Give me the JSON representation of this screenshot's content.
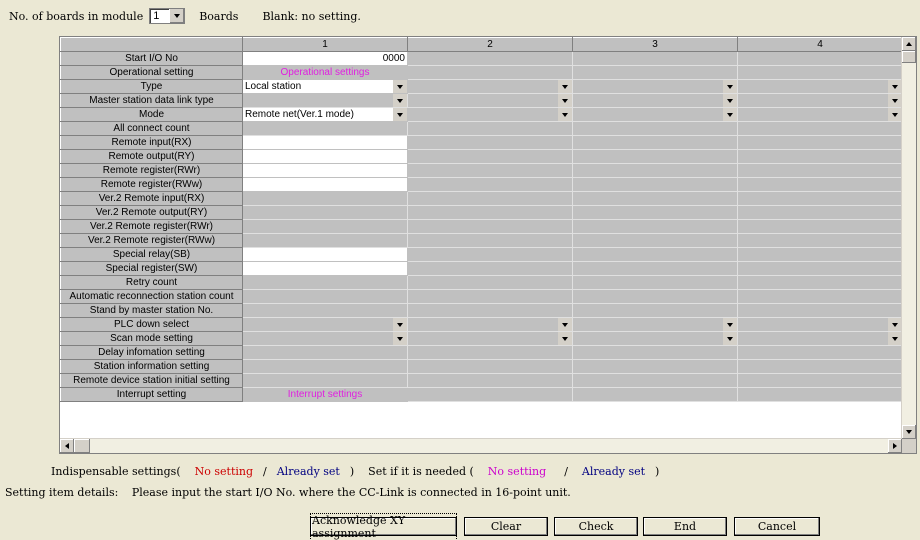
{
  "top": {
    "boards_label": "No. of boards in module",
    "boards_value": "1",
    "boards_unit": "Boards",
    "blank_note": "Blank: no setting."
  },
  "grid": {
    "columns": [
      "1",
      "2",
      "3",
      "4"
    ],
    "rows": [
      {
        "label": "Start I/O No",
        "cells": [
          {
            "t": "w",
            "v": "0000",
            "num": true
          },
          {
            "t": "g"
          },
          {
            "t": "g"
          },
          {
            "t": "g"
          }
        ]
      },
      {
        "label": "Operational setting",
        "cells": [
          {
            "t": "link",
            "v": "Operational settings"
          },
          {
            "t": "g"
          },
          {
            "t": "g"
          },
          {
            "t": "g"
          }
        ]
      },
      {
        "label": "Type",
        "cells": [
          {
            "t": "combo",
            "v": "Local station",
            "bg": "w"
          },
          {
            "t": "combo",
            "v": ""
          },
          {
            "t": "combo",
            "v": ""
          },
          {
            "t": "combo",
            "v": ""
          }
        ]
      },
      {
        "label": "Master station data link type",
        "cells": [
          {
            "t": "combo",
            "v": ""
          },
          {
            "t": "combo",
            "v": ""
          },
          {
            "t": "combo",
            "v": ""
          },
          {
            "t": "combo",
            "v": ""
          }
        ]
      },
      {
        "label": "Mode",
        "cells": [
          {
            "t": "combo",
            "v": "Remote net(Ver.1 mode)",
            "bg": "w"
          },
          {
            "t": "combo",
            "v": ""
          },
          {
            "t": "combo",
            "v": ""
          },
          {
            "t": "combo",
            "v": ""
          }
        ]
      },
      {
        "label": "All connect count",
        "cells": [
          {
            "t": "g"
          },
          {
            "t": "g"
          },
          {
            "t": "g"
          },
          {
            "t": "g"
          }
        ]
      },
      {
        "label": "Remote input(RX)",
        "cells": [
          {
            "t": "w",
            "v": ""
          },
          {
            "t": "g"
          },
          {
            "t": "g"
          },
          {
            "t": "g"
          }
        ]
      },
      {
        "label": "Remote output(RY)",
        "cells": [
          {
            "t": "w",
            "v": ""
          },
          {
            "t": "g"
          },
          {
            "t": "g"
          },
          {
            "t": "g"
          }
        ]
      },
      {
        "label": "Remote register(RWr)",
        "cells": [
          {
            "t": "w",
            "v": ""
          },
          {
            "t": "g"
          },
          {
            "t": "g"
          },
          {
            "t": "g"
          }
        ]
      },
      {
        "label": "Remote register(RWw)",
        "cells": [
          {
            "t": "w",
            "v": ""
          },
          {
            "t": "g"
          },
          {
            "t": "g"
          },
          {
            "t": "g"
          }
        ]
      },
      {
        "label": "Ver.2 Remote input(RX)",
        "cells": [
          {
            "t": "g"
          },
          {
            "t": "g"
          },
          {
            "t": "g"
          },
          {
            "t": "g"
          }
        ]
      },
      {
        "label": "Ver.2 Remote output(RY)",
        "cells": [
          {
            "t": "g"
          },
          {
            "t": "g"
          },
          {
            "t": "g"
          },
          {
            "t": "g"
          }
        ]
      },
      {
        "label": "Ver.2 Remote register(RWr)",
        "cells": [
          {
            "t": "g"
          },
          {
            "t": "g"
          },
          {
            "t": "g"
          },
          {
            "t": "g"
          }
        ]
      },
      {
        "label": "Ver.2 Remote register(RWw)",
        "cells": [
          {
            "t": "g"
          },
          {
            "t": "g"
          },
          {
            "t": "g"
          },
          {
            "t": "g"
          }
        ]
      },
      {
        "label": "Special relay(SB)",
        "cells": [
          {
            "t": "w",
            "v": ""
          },
          {
            "t": "g"
          },
          {
            "t": "g"
          },
          {
            "t": "g"
          }
        ]
      },
      {
        "label": "Special register(SW)",
        "cells": [
          {
            "t": "w",
            "v": ""
          },
          {
            "t": "g"
          },
          {
            "t": "g"
          },
          {
            "t": "g"
          }
        ]
      },
      {
        "label": "Retry count",
        "cells": [
          {
            "t": "g"
          },
          {
            "t": "g"
          },
          {
            "t": "g"
          },
          {
            "t": "g"
          }
        ]
      },
      {
        "label": "Automatic reconnection station count",
        "cells": [
          {
            "t": "g"
          },
          {
            "t": "g"
          },
          {
            "t": "g"
          },
          {
            "t": "g"
          }
        ]
      },
      {
        "label": "Stand by master station No.",
        "cells": [
          {
            "t": "g"
          },
          {
            "t": "g"
          },
          {
            "t": "g"
          },
          {
            "t": "g"
          }
        ]
      },
      {
        "label": "PLC down select",
        "cells": [
          {
            "t": "combo",
            "v": ""
          },
          {
            "t": "combo",
            "v": ""
          },
          {
            "t": "combo",
            "v": ""
          },
          {
            "t": "combo",
            "v": ""
          }
        ]
      },
      {
        "label": "Scan mode setting",
        "cells": [
          {
            "t": "combo",
            "v": ""
          },
          {
            "t": "combo",
            "v": ""
          },
          {
            "t": "combo",
            "v": ""
          },
          {
            "t": "combo",
            "v": ""
          }
        ]
      },
      {
        "label": "Delay infomation setting",
        "cells": [
          {
            "t": "g"
          },
          {
            "t": "g"
          },
          {
            "t": "g"
          },
          {
            "t": "g"
          }
        ]
      },
      {
        "label": "Station information setting",
        "cells": [
          {
            "t": "g"
          },
          {
            "t": "g"
          },
          {
            "t": "g"
          },
          {
            "t": "g"
          }
        ]
      },
      {
        "label": "Remote device station initial setting",
        "cells": [
          {
            "t": "g"
          },
          {
            "t": "g"
          },
          {
            "t": "g"
          },
          {
            "t": "g"
          }
        ]
      },
      {
        "label": "Interrupt setting",
        "cells": [
          {
            "t": "link",
            "v": "Interrupt settings"
          },
          {
            "t": "g"
          },
          {
            "t": "g"
          },
          {
            "t": "g"
          }
        ]
      }
    ]
  },
  "legend": {
    "indispensable": "Indispensable settings(",
    "no_setting": "No setting",
    "slash": "/",
    "already_set": "Already set",
    "close": ")",
    "if_needed": "Set if it is needed (",
    "no_setting2": "No setting",
    "already_set2": "Already set",
    "close2": ")"
  },
  "details": {
    "label": "Setting item details:",
    "text": "Please input the start I/O No. where the CC-Link is connected in 16-point unit."
  },
  "buttons": {
    "acknowledge": "Acknowledge XY assignment",
    "clear": "Clear",
    "check": "Check",
    "end": "End",
    "cancel": "Cancel"
  },
  "colors": {
    "background": "#ebe8d4",
    "header_gray": "#c0c0c0",
    "link_magenta": "#e020e0",
    "red": "#cc0000",
    "navy": "#000080"
  }
}
